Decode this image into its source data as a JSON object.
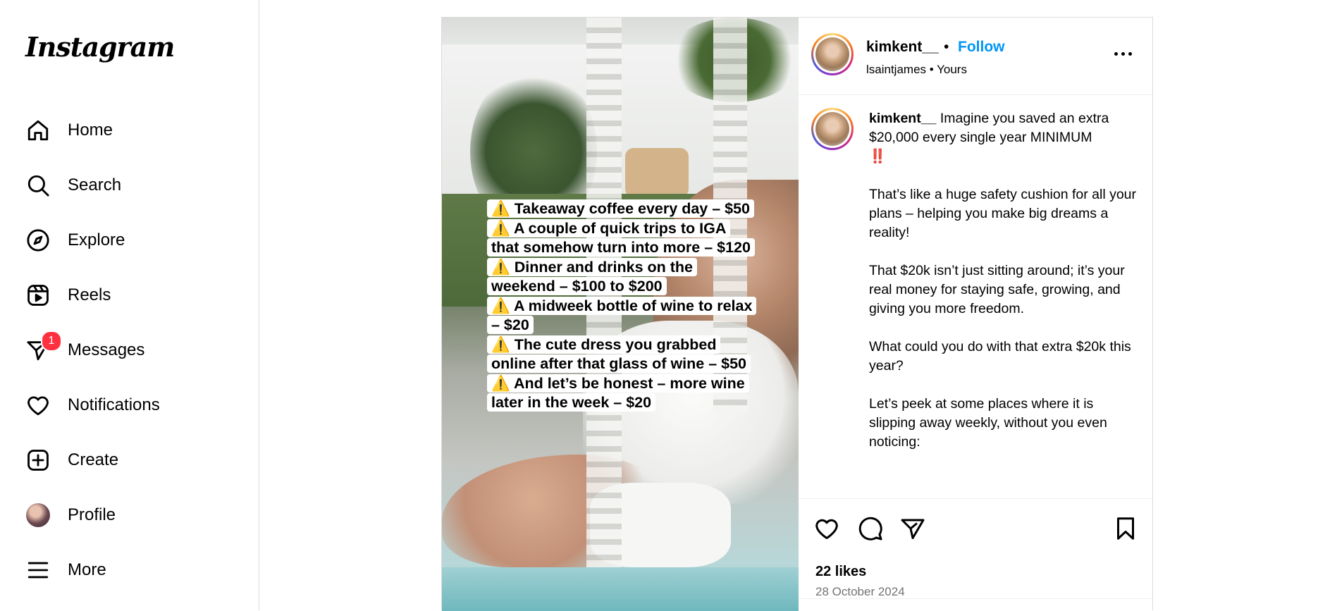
{
  "app": {
    "logo": "Instagram"
  },
  "sidebar": {
    "items": [
      {
        "label": "Home"
      },
      {
        "label": "Search"
      },
      {
        "label": "Explore"
      },
      {
        "label": "Reels"
      },
      {
        "label": "Messages",
        "badge": "1"
      },
      {
        "label": "Notifications"
      },
      {
        "label": "Create"
      },
      {
        "label": "Profile"
      },
      {
        "label": "More"
      }
    ]
  },
  "post": {
    "username": "kimkent__",
    "dot": "•",
    "follow_label": "Follow",
    "audio_line": "lsaintjames • Yours",
    "overlay_lines": [
      "⚠️ Takeaway coffee every day – $50",
      "⚠️ A couple of quick trips to IGA that somehow turn into more – $120",
      "⚠️ Dinner and drinks on the weekend – $100 to $200",
      "⚠️ A midweek bottle of wine to relax – $20",
      "⚠️ The cute dress you grabbed online after that glass of wine – $50",
      "⚠️ And let’s be honest – more wine later in the week – $20"
    ],
    "caption": {
      "username": "kimkent__",
      "first": "Imagine you saved an extra $20,000 every single year MINIMUM",
      "emphasis": "‼️",
      "paragraphs": [
        "That’s like a huge safety cushion for all your plans – helping you make big dreams a reality!",
        "That $20k isn’t just sitting around; it’s your real money for staying safe, growing, and giving you more freedom.",
        "What could you do with that extra $20k this year?",
        "Let’s peek at some places where it is slipping away weekly, without you even noticing:"
      ]
    },
    "likes": "22 likes",
    "date": "28 October 2024"
  },
  "colors": {
    "accent": "#0095f6",
    "badge": "#ff3040",
    "muted": "#737373"
  }
}
